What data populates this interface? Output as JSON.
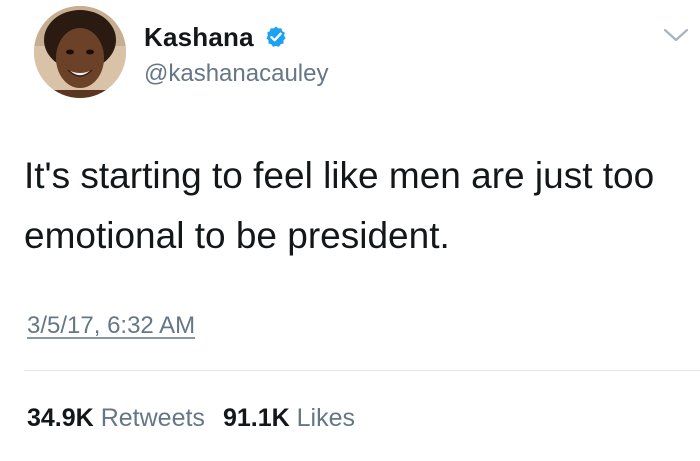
{
  "tweet": {
    "author": {
      "display_name": "Kashana",
      "handle": "@kashanacauley",
      "verified": true,
      "avatar_icon": "profile-photo-icon"
    },
    "menu_icon": "chevron-down-icon",
    "text": "It's starting to feel like men are just too emotional to be president.",
    "timestamp": "3/5/17, 6:32 AM",
    "stats": {
      "retweets_count": "34.9K",
      "retweets_label": "Retweets",
      "likes_count": "91.1K",
      "likes_label": "Likes"
    }
  },
  "colors": {
    "primary_text": "#14171a",
    "secondary_text": "#657786",
    "verified_blue": "#1da1f2",
    "divider": "#e1e8ed",
    "background": "#ffffff"
  }
}
